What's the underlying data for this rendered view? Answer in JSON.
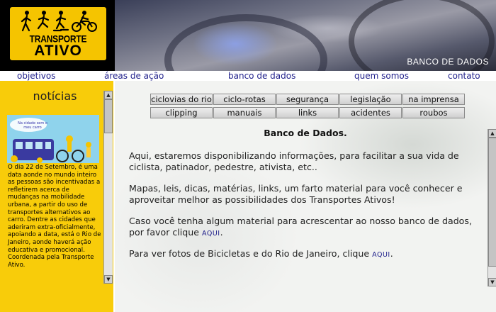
{
  "logo": {
    "line1": "TRANSPORTE",
    "line2": "ATIVO"
  },
  "banner": {
    "label": "BANCO DE DADOS"
  },
  "nav": {
    "items": [
      {
        "label": "objetivos"
      },
      {
        "label": "áreas de ação"
      },
      {
        "label": "banco de dados"
      },
      {
        "label": "quem somos"
      },
      {
        "label": "contato"
      }
    ]
  },
  "sidebar": {
    "heading": "notícias",
    "image_caption": "Na cidade sem o meu carro",
    "news_text": "O dia 22 de Setembro, é uma data aonde no mundo inteiro as pessoas são incentivadas a refletirem acerca de mudanças na mobilidade urbana, a partir do uso de transportes alternativos ao carro. Dentre as cidades que aderiram extra-oficialmente, apoiando a data, está o Rio de Janeiro, aonde haverá ação educativa e promocional. Coordenada pela Transporte Ativo."
  },
  "tabs": {
    "row1": [
      "ciclovias do rio",
      "ciclo-rotas",
      "segurança",
      "legislação",
      "na imprensa"
    ],
    "row2": [
      "clipping",
      "manuais",
      "links",
      "acidentes",
      "roubos"
    ]
  },
  "content": {
    "title": "Banco de Dados.",
    "p1": "Aqui, estaremos disponibilizando informações, para facilitar a sua vida de ciclista, patinador, pedestre, ativista, etc..",
    "p2": "Mapas, leis, dicas, matérias, links, um farto material para você conhecer e aproveitar melhor as possibilidades dos Transportes Ativos!",
    "p3": "Caso você tenha algum material para acrescentar ao nosso banco de dados, por favor clique",
    "p3_link": "AQUI",
    "p3_end": ".",
    "p4": "Para ver fotos de Bicicletas e do Rio de Janeiro, clique",
    "p4_link": "AQUI",
    "p4_end": "."
  },
  "colors": {
    "accent_yellow": "#f8cc0a",
    "link_blue": "#21218c"
  },
  "icons": {
    "scroll_up": "triangle-up-icon",
    "scroll_down": "triangle-down-icon"
  }
}
